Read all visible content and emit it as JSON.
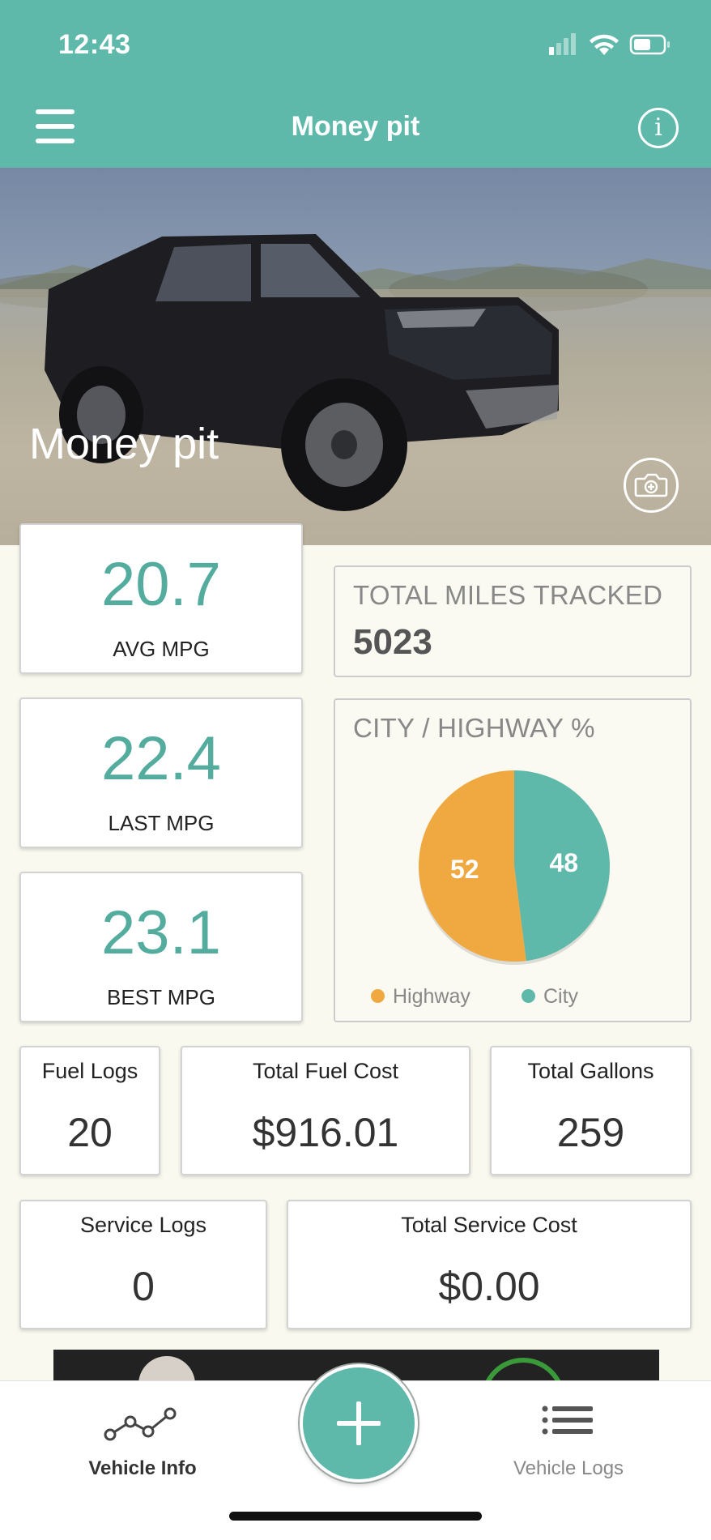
{
  "status_bar": {
    "time": "12:43"
  },
  "header": {
    "title": "Money pit"
  },
  "hero": {
    "vehicle_name": "Money pit"
  },
  "stats": {
    "avg_mpg": {
      "value": "20.7",
      "label": "AVG MPG"
    },
    "last_mpg": {
      "value": "22.4",
      "label": "LAST MPG"
    },
    "best_mpg": {
      "value": "23.1",
      "label": "BEST MPG"
    }
  },
  "miles": {
    "caption": "TOTAL MILES TRACKED",
    "value": "5023"
  },
  "city_highway": {
    "caption": "CITY / HIGHWAY %",
    "highway_label": "Highway",
    "city_label": "City",
    "highway_value": "52",
    "city_value": "48",
    "highway_color": "#f0a941",
    "city_color": "#5fb9aa"
  },
  "chart_data": {
    "type": "pie",
    "title": "CITY / HIGHWAY %",
    "categories": [
      "Highway",
      "City"
    ],
    "values": [
      52,
      48
    ],
    "colors": [
      "#f0a941",
      "#5fb9aa"
    ],
    "legend": "bottom"
  },
  "fuel": {
    "logs_label": "Fuel Logs",
    "logs_value": "20",
    "cost_label": "Total Fuel Cost",
    "cost_value": "$916.01",
    "gallons_label": "Total Gallons",
    "gallons_value": "259"
  },
  "service": {
    "logs_label": "Service Logs",
    "logs_value": "0",
    "cost_label": "Total Service Cost",
    "cost_value": "$0.00"
  },
  "tabs": {
    "vehicle_info": "Vehicle Info",
    "vehicle_logs": "Vehicle Logs"
  },
  "colors": {
    "accent": "#5fb9aa",
    "highway": "#f0a941",
    "background": "#faf9ef"
  }
}
